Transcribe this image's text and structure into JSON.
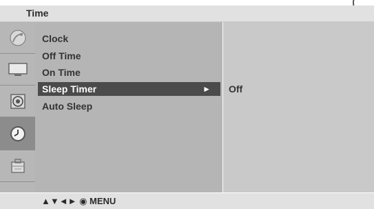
{
  "header": {
    "title": "Time"
  },
  "sidebar": {
    "icons": [
      {
        "name": "satellite-dish-icon",
        "active": false
      },
      {
        "name": "monitor-icon",
        "active": false
      },
      {
        "name": "speaker-icon",
        "active": false
      },
      {
        "name": "clock-icon",
        "active": true
      },
      {
        "name": "toolbox-icon",
        "active": false
      }
    ]
  },
  "menu": {
    "items": [
      {
        "label": "Clock"
      },
      {
        "label": "Off Time"
      },
      {
        "label": "On Time"
      },
      {
        "label": "Sleep Timer",
        "selected": true,
        "arrow": "►"
      },
      {
        "label": "Auto Sleep"
      }
    ]
  },
  "value": {
    "text": "Off"
  },
  "navigation": {
    "hint": "▲▼◄► ◉ MENU"
  }
}
